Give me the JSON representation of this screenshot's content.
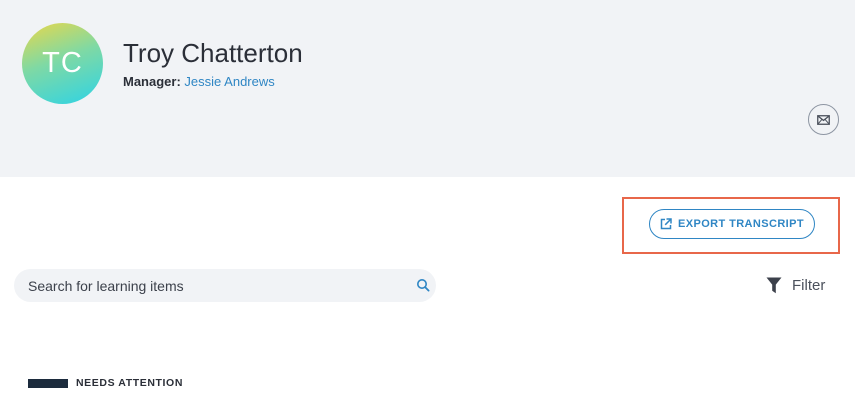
{
  "profile": {
    "initials": "TC",
    "name": "Troy Chatterton",
    "manager_label": "Manager:",
    "manager_name": "Jessie Andrews"
  },
  "actions": {
    "email_icon": "mail-icon",
    "export_label": "EXPORT TRANSCRIPT",
    "export_icon": "external-link-icon"
  },
  "search": {
    "placeholder": "Search for learning items",
    "value": "",
    "icon": "search-icon"
  },
  "filter": {
    "label": "Filter",
    "icon": "funnel-icon"
  },
  "section": {
    "title": "NEEDS ATTENTION"
  },
  "colors": {
    "accent": "#2f86c4",
    "highlight": "#e8674a",
    "header_bg": "#f1f3f6",
    "section_bar": "#1c2b3d"
  }
}
